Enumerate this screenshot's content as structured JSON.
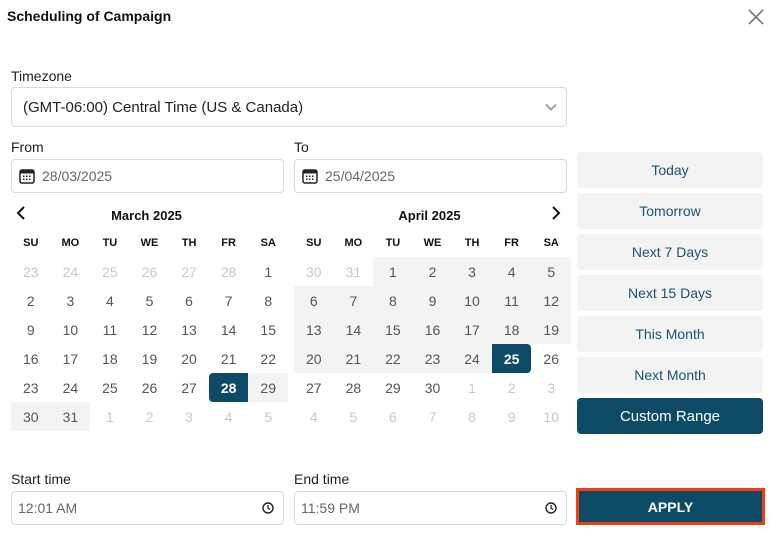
{
  "dialog": {
    "title": "Scheduling of Campaign",
    "close_icon": "close-icon"
  },
  "timezone": {
    "label": "Timezone",
    "value": "(GMT-06:00) Central Time (US & Canada)"
  },
  "from": {
    "label": "From",
    "value": "28/03/2025"
  },
  "to": {
    "label": "To",
    "value": "25/04/2025"
  },
  "calendars": [
    {
      "title": "March 2025",
      "weekdays": [
        "SU",
        "MO",
        "TU",
        "WE",
        "TH",
        "FR",
        "SA"
      ],
      "days": [
        {
          "d": "23",
          "state": "muted"
        },
        {
          "d": "24",
          "state": "muted"
        },
        {
          "d": "25",
          "state": "muted"
        },
        {
          "d": "26",
          "state": "muted"
        },
        {
          "d": "27",
          "state": "muted"
        },
        {
          "d": "28",
          "state": "muted"
        },
        {
          "d": "1",
          "state": ""
        },
        {
          "d": "2",
          "state": ""
        },
        {
          "d": "3",
          "state": ""
        },
        {
          "d": "4",
          "state": ""
        },
        {
          "d": "5",
          "state": ""
        },
        {
          "d": "6",
          "state": ""
        },
        {
          "d": "7",
          "state": ""
        },
        {
          "d": "8",
          "state": ""
        },
        {
          "d": "9",
          "state": ""
        },
        {
          "d": "10",
          "state": ""
        },
        {
          "d": "11",
          "state": ""
        },
        {
          "d": "12",
          "state": ""
        },
        {
          "d": "13",
          "state": ""
        },
        {
          "d": "14",
          "state": ""
        },
        {
          "d": "15",
          "state": ""
        },
        {
          "d": "16",
          "state": ""
        },
        {
          "d": "17",
          "state": ""
        },
        {
          "d": "18",
          "state": ""
        },
        {
          "d": "19",
          "state": ""
        },
        {
          "d": "20",
          "state": ""
        },
        {
          "d": "21",
          "state": ""
        },
        {
          "d": "22",
          "state": ""
        },
        {
          "d": "23",
          "state": ""
        },
        {
          "d": "24",
          "state": ""
        },
        {
          "d": "25",
          "state": ""
        },
        {
          "d": "26",
          "state": ""
        },
        {
          "d": "27",
          "state": ""
        },
        {
          "d": "28",
          "state": "selected sel-start"
        },
        {
          "d": "29",
          "state": "range"
        },
        {
          "d": "30",
          "state": "range"
        },
        {
          "d": "31",
          "state": "range"
        },
        {
          "d": "1",
          "state": "muted"
        },
        {
          "d": "2",
          "state": "muted"
        },
        {
          "d": "3",
          "state": "muted"
        },
        {
          "d": "4",
          "state": "muted"
        },
        {
          "d": "5",
          "state": "muted"
        }
      ]
    },
    {
      "title": "April 2025",
      "weekdays": [
        "SU",
        "MO",
        "TU",
        "WE",
        "TH",
        "FR",
        "SA"
      ],
      "days": [
        {
          "d": "30",
          "state": "muted"
        },
        {
          "d": "31",
          "state": "muted"
        },
        {
          "d": "1",
          "state": "range"
        },
        {
          "d": "2",
          "state": "range"
        },
        {
          "d": "3",
          "state": "range"
        },
        {
          "d": "4",
          "state": "range"
        },
        {
          "d": "5",
          "state": "range"
        },
        {
          "d": "6",
          "state": "range"
        },
        {
          "d": "7",
          "state": "range"
        },
        {
          "d": "8",
          "state": "range"
        },
        {
          "d": "9",
          "state": "range"
        },
        {
          "d": "10",
          "state": "range"
        },
        {
          "d": "11",
          "state": "range"
        },
        {
          "d": "12",
          "state": "range"
        },
        {
          "d": "13",
          "state": "range"
        },
        {
          "d": "14",
          "state": "range"
        },
        {
          "d": "15",
          "state": "range"
        },
        {
          "d": "16",
          "state": "range"
        },
        {
          "d": "17",
          "state": "range"
        },
        {
          "d": "18",
          "state": "range"
        },
        {
          "d": "19",
          "state": "range"
        },
        {
          "d": "20",
          "state": "range"
        },
        {
          "d": "21",
          "state": "range"
        },
        {
          "d": "22",
          "state": "range"
        },
        {
          "d": "23",
          "state": "range"
        },
        {
          "d": "24",
          "state": "range"
        },
        {
          "d": "25",
          "state": "selected sel-end"
        },
        {
          "d": "26",
          "state": ""
        },
        {
          "d": "27",
          "state": ""
        },
        {
          "d": "28",
          "state": ""
        },
        {
          "d": "29",
          "state": ""
        },
        {
          "d": "30",
          "state": ""
        },
        {
          "d": "1",
          "state": "muted"
        },
        {
          "d": "2",
          "state": "muted"
        },
        {
          "d": "3",
          "state": "muted"
        },
        {
          "d": "4",
          "state": "muted"
        },
        {
          "d": "5",
          "state": "muted"
        },
        {
          "d": "6",
          "state": "muted"
        },
        {
          "d": "7",
          "state": "muted"
        },
        {
          "d": "8",
          "state": "muted"
        },
        {
          "d": "9",
          "state": "muted"
        },
        {
          "d": "10",
          "state": "muted"
        }
      ]
    }
  ],
  "presets": [
    {
      "label": "Today",
      "active": false
    },
    {
      "label": "Tomorrow",
      "active": false
    },
    {
      "label": "Next 7 Days",
      "active": false
    },
    {
      "label": "Next 15 Days",
      "active": false
    },
    {
      "label": "This Month",
      "active": false
    },
    {
      "label": "Next Month",
      "active": false
    },
    {
      "label": "Custom Range",
      "active": true
    }
  ],
  "start_time": {
    "label": "Start time",
    "value": "12:01 AM"
  },
  "end_time": {
    "label": "End time",
    "value": "11:59 PM"
  },
  "apply_label": "APPLY",
  "colors": {
    "primary": "#0c4a66",
    "range_bg": "#f3f3f3",
    "apply_border": "#f03e10",
    "preset_text": "#1a5270"
  }
}
